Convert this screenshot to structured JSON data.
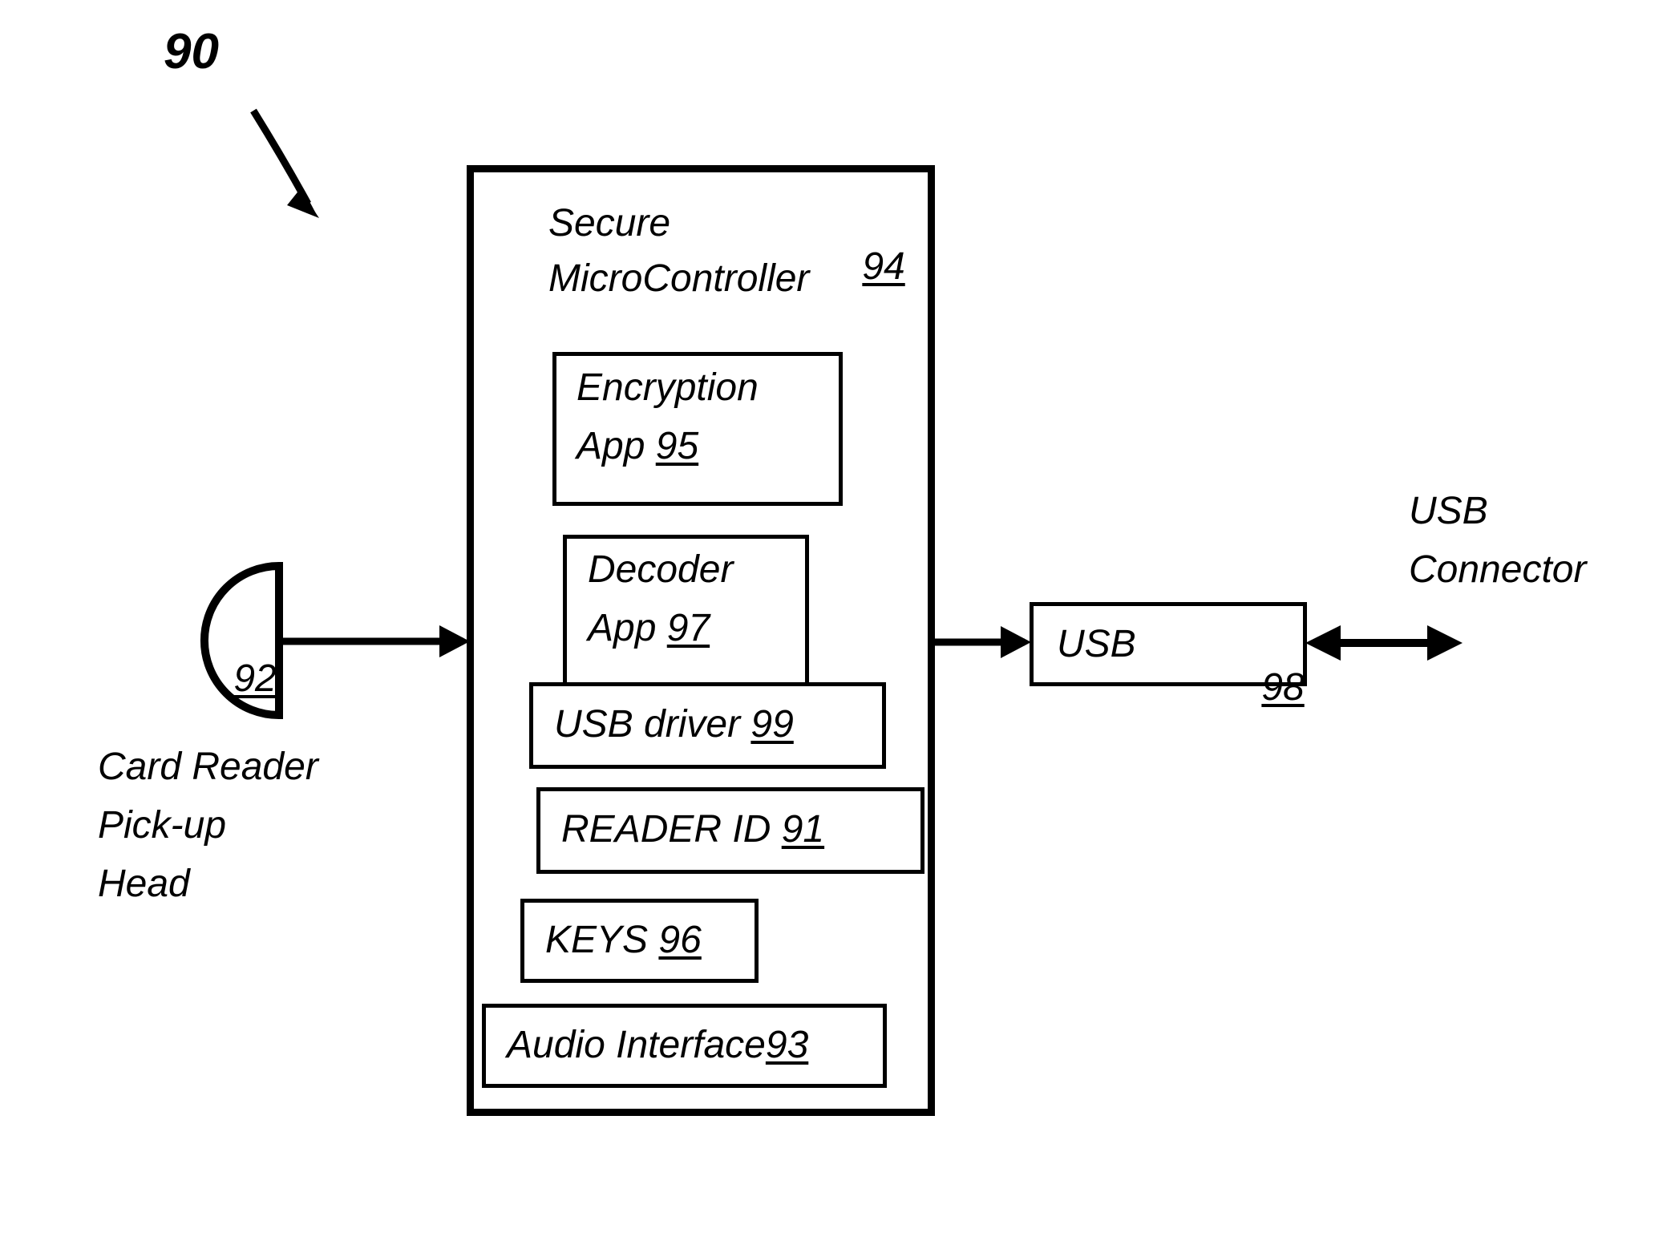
{
  "figure": {
    "reference_callout": "90",
    "main_block": {
      "title_line1": "Secure",
      "title_line2": "MicroController",
      "ref": "94"
    },
    "inner_blocks": [
      {
        "name": "encryption-app",
        "line1": "Encryption",
        "line2_text": "App ",
        "ref": "95"
      },
      {
        "name": "decoder-app",
        "line1": "Decoder",
        "line2_text": "App ",
        "ref": "97"
      },
      {
        "name": "usb-driver",
        "text": "USB driver ",
        "ref": "99"
      },
      {
        "name": "reader-id",
        "text": "READER ID ",
        "ref": "91"
      },
      {
        "name": "keys",
        "text": "KEYS ",
        "ref": "96"
      },
      {
        "name": "audio-interface",
        "text": "Audio Interface",
        "ref": "93"
      }
    ],
    "pickup_head": {
      "ref": "92",
      "caption_line1": "Card Reader",
      "caption_line2": "Pick-up",
      "caption_line3": "Head"
    },
    "usb_block": {
      "label": "USB",
      "ref": "98"
    },
    "usb_connector": {
      "caption_line1": "USB",
      "caption_line2": "Connector"
    }
  },
  "colors": {
    "stroke": "#000000",
    "background": "#ffffff"
  }
}
